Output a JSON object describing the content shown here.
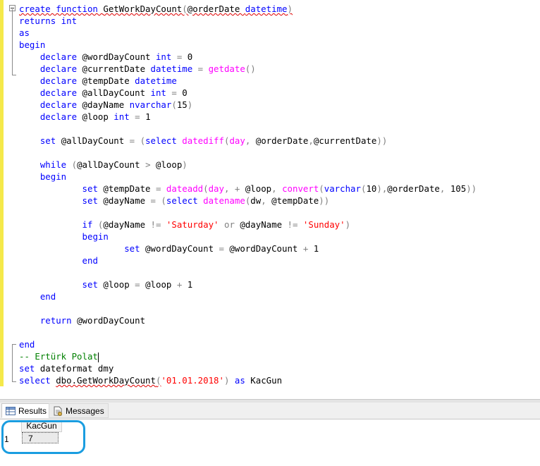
{
  "editor": {
    "lines": [
      [
        [
          "kw squig",
          "create function "
        ],
        [
          "squig",
          "GetWorkDayCount"
        ],
        [
          "op squig",
          "("
        ],
        [
          "squig",
          "@orderDate "
        ],
        [
          "kw squig",
          "datetime"
        ],
        [
          "op squig",
          ")"
        ]
      ],
      [
        [
          "kw",
          "returns int"
        ]
      ],
      [
        [
          "kw",
          "as"
        ]
      ],
      [
        [
          "kw",
          "begin"
        ]
      ],
      [
        [
          "",
          "    "
        ],
        [
          "kw",
          "declare "
        ],
        [
          "",
          "@wordDayCount "
        ],
        [
          "kw",
          "int "
        ],
        [
          "op",
          "= "
        ],
        [
          "",
          "0"
        ]
      ],
      [
        [
          "",
          "    "
        ],
        [
          "kw",
          "declare "
        ],
        [
          "",
          "@currentDate "
        ],
        [
          "kw",
          "datetime "
        ],
        [
          "op",
          "= "
        ],
        [
          "fn",
          "getdate"
        ],
        [
          "op",
          "()"
        ]
      ],
      [
        [
          "",
          "    "
        ],
        [
          "kw",
          "declare "
        ],
        [
          "",
          "@tempDate "
        ],
        [
          "kw",
          "datetime"
        ]
      ],
      [
        [
          "",
          "    "
        ],
        [
          "kw",
          "declare "
        ],
        [
          "",
          "@allDayCount "
        ],
        [
          "kw",
          "int "
        ],
        [
          "op",
          "= "
        ],
        [
          "",
          "0"
        ]
      ],
      [
        [
          "",
          "    "
        ],
        [
          "kw",
          "declare "
        ],
        [
          "",
          "@dayName "
        ],
        [
          "kw",
          "nvarchar"
        ],
        [
          "op",
          "("
        ],
        [
          "",
          "15"
        ],
        [
          "op",
          ")"
        ]
      ],
      [
        [
          "",
          "    "
        ],
        [
          "kw",
          "declare "
        ],
        [
          "",
          "@loop "
        ],
        [
          "kw",
          "int "
        ],
        [
          "op",
          "= "
        ],
        [
          "",
          "1"
        ]
      ],
      [
        [
          "",
          ""
        ]
      ],
      [
        [
          "",
          "    "
        ],
        [
          "kw",
          "set "
        ],
        [
          "",
          "@allDayCount "
        ],
        [
          "op",
          "= ("
        ],
        [
          "kw",
          "select "
        ],
        [
          "fn",
          "datediff"
        ],
        [
          "op",
          "("
        ],
        [
          "fn",
          "day"
        ],
        [
          "op",
          ", "
        ],
        [
          "",
          "@orderDate"
        ],
        [
          "op",
          ","
        ],
        [
          "",
          "@currentDate"
        ],
        [
          "op",
          "))"
        ]
      ],
      [
        [
          "",
          ""
        ]
      ],
      [
        [
          "",
          "    "
        ],
        [
          "kw",
          "while "
        ],
        [
          "op",
          "("
        ],
        [
          "",
          "@allDayCount "
        ],
        [
          "op",
          "> "
        ],
        [
          "",
          "@loop"
        ],
        [
          "op",
          ")"
        ]
      ],
      [
        [
          "",
          "    "
        ],
        [
          "kw",
          "begin"
        ]
      ],
      [
        [
          "",
          "            "
        ],
        [
          "kw",
          "set "
        ],
        [
          "",
          "@tempDate "
        ],
        [
          "op",
          "= "
        ],
        [
          "fn",
          "dateadd"
        ],
        [
          "op",
          "("
        ],
        [
          "fn",
          "day"
        ],
        [
          "op",
          ", + "
        ],
        [
          "",
          "@loop"
        ],
        [
          "op",
          ", "
        ],
        [
          "fn",
          "convert"
        ],
        [
          "op",
          "("
        ],
        [
          "kw",
          "varchar"
        ],
        [
          "op",
          "("
        ],
        [
          "",
          "10"
        ],
        [
          "op",
          "),"
        ],
        [
          "",
          "@orderDate"
        ],
        [
          "op",
          ", "
        ],
        [
          "",
          "105"
        ],
        [
          "op",
          "))"
        ]
      ],
      [
        [
          "",
          "            "
        ],
        [
          "kw",
          "set "
        ],
        [
          "",
          "@dayName "
        ],
        [
          "op",
          "= ("
        ],
        [
          "kw",
          "select "
        ],
        [
          "fn",
          "datename"
        ],
        [
          "op",
          "("
        ],
        [
          "",
          "dw"
        ],
        [
          "op",
          ", "
        ],
        [
          "",
          "@tempDate"
        ],
        [
          "op",
          "))"
        ]
      ],
      [
        [
          "",
          ""
        ]
      ],
      [
        [
          "",
          "            "
        ],
        [
          "kw",
          "if "
        ],
        [
          "op",
          "("
        ],
        [
          "",
          "@dayName "
        ],
        [
          "op",
          "!= "
        ],
        [
          "str",
          "'Saturday' "
        ],
        [
          "op",
          "or "
        ],
        [
          "",
          "@dayName "
        ],
        [
          "op",
          "!= "
        ],
        [
          "str",
          "'Sunday'"
        ],
        [
          "op",
          ")"
        ]
      ],
      [
        [
          "",
          "            "
        ],
        [
          "kw",
          "begin"
        ]
      ],
      [
        [
          "",
          "                    "
        ],
        [
          "kw",
          "set "
        ],
        [
          "",
          "@wordDayCount "
        ],
        [
          "op",
          "= "
        ],
        [
          "",
          "@wordDayCount "
        ],
        [
          "op",
          "+ "
        ],
        [
          "",
          "1"
        ]
      ],
      [
        [
          "",
          "            "
        ],
        [
          "kw",
          "end"
        ]
      ],
      [
        [
          "",
          ""
        ]
      ],
      [
        [
          "",
          "            "
        ],
        [
          "kw",
          "set "
        ],
        [
          "",
          "@loop "
        ],
        [
          "op",
          "= "
        ],
        [
          "",
          "@loop "
        ],
        [
          "op",
          "+ "
        ],
        [
          "",
          "1"
        ]
      ],
      [
        [
          "",
          "    "
        ],
        [
          "kw",
          "end"
        ]
      ],
      [
        [
          "",
          ""
        ]
      ],
      [
        [
          "",
          "    "
        ],
        [
          "kw",
          "return "
        ],
        [
          "",
          "@wordDayCount"
        ]
      ],
      [
        [
          "",
          ""
        ]
      ],
      [
        [
          "kw",
          "end"
        ]
      ],
      [
        [
          "cmt",
          "-- Ertürk Polat"
        ],
        [
          "caret",
          ""
        ]
      ],
      [
        [
          "kw",
          "set "
        ],
        [
          "",
          "dateformat dmy"
        ]
      ],
      [
        [
          "kw",
          "select "
        ],
        [
          "squig",
          "dbo.GetWorkDayCount"
        ],
        [
          "op squig",
          "("
        ],
        [
          "str",
          "'01.01.2018'"
        ],
        [
          "op",
          ") "
        ],
        [
          "kw",
          "as "
        ],
        [
          "",
          "KacGun"
        ]
      ]
    ]
  },
  "tabs": {
    "results_label": "Results",
    "messages_label": "Messages"
  },
  "results": {
    "column_header": "KacGun",
    "row_number": "1",
    "cell_value": "7"
  }
}
